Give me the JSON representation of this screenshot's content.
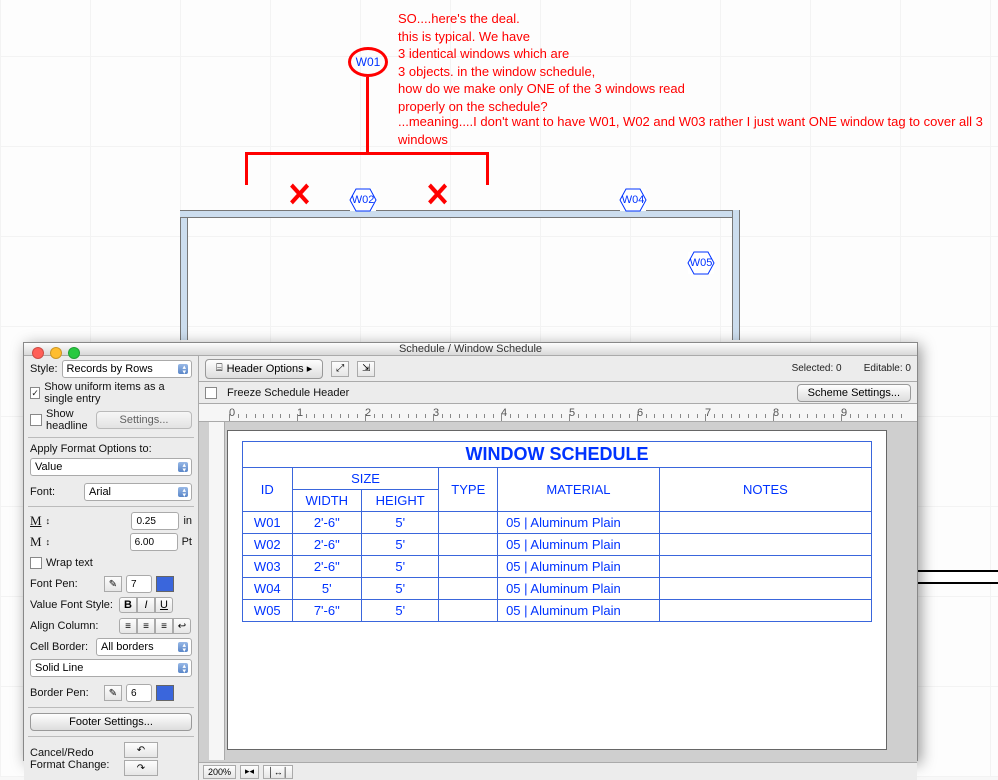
{
  "annotations": {
    "main": "SO....here's the deal.\nthis is typical. We have\n3 identical windows which are\n3 objects. in the window schedule,\nhow do we make only ONE of the 3 windows read\nproperly on the schedule?",
    "sub": "...meaning....I don't want to have W01, W02 and W03 rather I just want ONE window tag to cover all 3 windows",
    "w01": "W01"
  },
  "plan_tags": {
    "w02": "W02",
    "w04": "W04",
    "w05": "W05"
  },
  "dialog": {
    "title": "Schedule  /  Window Schedule",
    "toolbar": {
      "header_options": "Header Options ▸",
      "selected": "Selected:   0",
      "editable": "Editable:   0"
    },
    "subbar": {
      "freeze": "Freeze Schedule Header",
      "scheme": "Scheme Settings..."
    },
    "sidebar": {
      "style_label": "Style:",
      "style_value": "Records by Rows",
      "show_uniform": "Show uniform items as a single entry",
      "show_headline": "Show headline",
      "settings_btn": "Settings...",
      "apply_label": "Apply Format Options to:",
      "apply_value": "Value",
      "font_label": "Font:",
      "font_value": "Arial",
      "height_val": "0.25",
      "height_unit": "in",
      "pt_val": "6.00",
      "pt_unit": "Pt",
      "wrap": "Wrap text",
      "font_pen": "Font Pen:",
      "font_pen_val": "7",
      "vfs": "Value Font Style:",
      "align": "Align Column:",
      "cell_border": "Cell Border:",
      "cell_border_val": "All borders",
      "line_style": "Solid Line",
      "border_pen": "Border Pen:",
      "border_pen_val": "6",
      "footer_btn": "Footer Settings...",
      "cancel_redo": "Cancel/Redo Format Change:"
    },
    "bottom": {
      "zoom": "200%"
    }
  },
  "schedule": {
    "title": "WINDOW SCHEDULE",
    "headers": {
      "id": "ID",
      "size": "SIZE",
      "width": "WIDTH",
      "height": "HEIGHT",
      "type": "TYPE",
      "material": "MATERIAL",
      "notes": "NOTES"
    },
    "rows": [
      {
        "id": "W01",
        "width": "2'-6\"",
        "height": "5'",
        "type": "",
        "material": "05 | Aluminum Plain",
        "notes": ""
      },
      {
        "id": "W02",
        "width": "2'-6\"",
        "height": "5'",
        "type": "",
        "material": "05 | Aluminum Plain",
        "notes": ""
      },
      {
        "id": "W03",
        "width": "2'-6\"",
        "height": "5'",
        "type": "",
        "material": "05 | Aluminum Plain",
        "notes": ""
      },
      {
        "id": "W04",
        "width": "5'",
        "height": "5'",
        "type": "",
        "material": "05 | Aluminum Plain",
        "notes": ""
      },
      {
        "id": "W05",
        "width": "7'-6\"",
        "height": "5'",
        "type": "",
        "material": "05 | Aluminum Plain",
        "notes": ""
      }
    ]
  },
  "chart_data": {
    "type": "table",
    "title": "WINDOW SCHEDULE",
    "columns": [
      "ID",
      "WIDTH",
      "HEIGHT",
      "TYPE",
      "MATERIAL",
      "NOTES"
    ],
    "rows": [
      [
        "W01",
        "2'-6\"",
        "5'",
        "",
        "05 | Aluminum Plain",
        ""
      ],
      [
        "W02",
        "2'-6\"",
        "5'",
        "",
        "05 | Aluminum Plain",
        ""
      ],
      [
        "W03",
        "2'-6\"",
        "5'",
        "",
        "05 | Aluminum Plain",
        ""
      ],
      [
        "W04",
        "5'",
        "5'",
        "",
        "05 | Aluminum Plain",
        ""
      ],
      [
        "W05",
        "7'-6\"",
        "5'",
        "",
        "05 | Aluminum Plain",
        ""
      ]
    ]
  }
}
